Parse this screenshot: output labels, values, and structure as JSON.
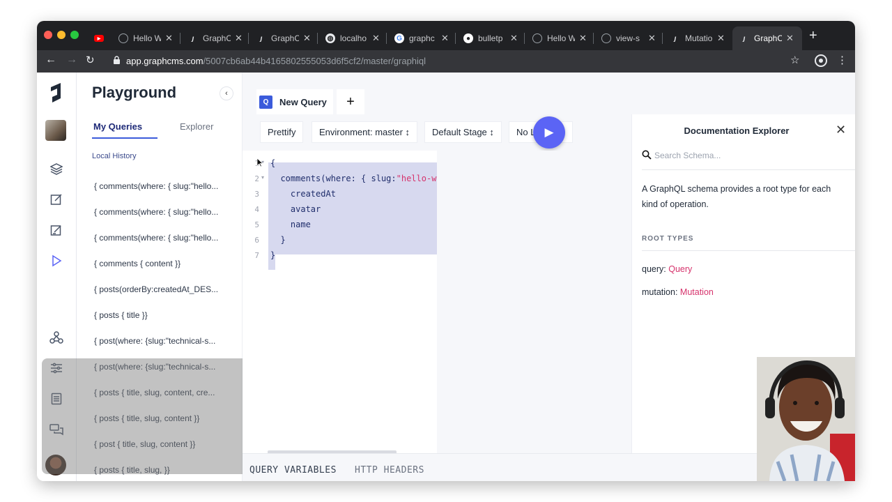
{
  "browser": {
    "tabs": [
      {
        "label": "",
        "icon": "youtube-icon"
      },
      {
        "label": "Hello W",
        "icon": "globe-icon"
      },
      {
        "label": "GraphC",
        "icon": "graphcms-icon"
      },
      {
        "label": "GraphC",
        "icon": "graphcms-icon"
      },
      {
        "label": "localho",
        "icon": "globe-icon"
      },
      {
        "label": "graphc",
        "icon": "google-icon"
      },
      {
        "label": "bulletp",
        "icon": "github-icon"
      },
      {
        "label": "Hello W",
        "icon": "globe-icon"
      },
      {
        "label": "view-s",
        "icon": "globe-icon"
      },
      {
        "label": "Mutatio",
        "icon": "graphcms-icon"
      },
      {
        "label": "GraphC",
        "icon": "graphcms-icon",
        "active": true
      }
    ],
    "url_host": "app.graphcms.com",
    "url_path": "/5007cb6ab44b4165802555053d6f5cf2/master/graphiql"
  },
  "sidebar": {
    "title": "Playground",
    "tabs": [
      "My Queries",
      "Explorer"
    ],
    "section_label": "Local History",
    "history": [
      "{ comments(where: { slug:\"hello...",
      "{ comments(where: { slug:\"hello...",
      "{ comments(where: { slug:\"hello...",
      "{ comments { content }}",
      "{ posts(orderBy:createdAt_DES...",
      "{ posts { title }}",
      "{ post(where: {slug:\"technical-s...",
      "{ post(where: {slug:\"technical-s...",
      "{ posts { title, slug, content, cre...",
      "{ posts { title, slug, content }}",
      "{ post { title, slug, content }}",
      "{ posts { title, slug, }}"
    ]
  },
  "editor_tabs": {
    "query_badge": "Q",
    "query_label": "New Query",
    "add_label": "+"
  },
  "toolbar": {
    "prettify": "Prettify",
    "environment": "Environment: master ↕",
    "stage": "Default Stage ↕",
    "locale": "No L"
  },
  "editor": {
    "line_numbers": [
      "1",
      "2",
      "3",
      "4",
      "5",
      "6",
      "7"
    ],
    "lines": [
      "{",
      "  comments(where: { slug:",
      "    createdAt",
      "    avatar",
      "    name",
      "  }",
      "}"
    ],
    "slug_value": "\"hello-wo"
  },
  "bottom_tabs": [
    "QUERY VARIABLES",
    "HTTP HEADERS"
  ],
  "docs": {
    "title": "Documentation Explorer",
    "search_placeholder": "Search Schema...",
    "description": "A GraphQL schema provides a root type for each kind of operation.",
    "root_types_label": "ROOT TYPES",
    "query_key": "query:",
    "query_type": "Query",
    "mutation_key": "mutation:",
    "mutation_type": "Mutation"
  },
  "colors": {
    "accent": "#3b5bdb",
    "run_button": "#5b64f5",
    "type_link": "#d6336c"
  }
}
